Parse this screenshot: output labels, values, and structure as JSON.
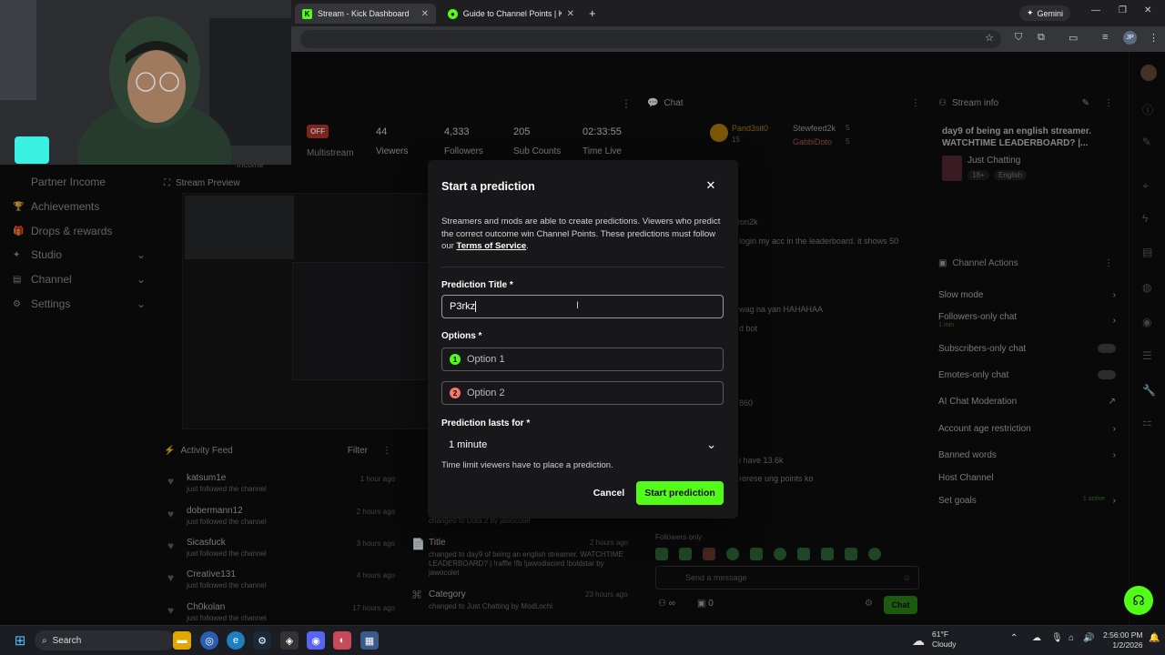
{
  "browser": {
    "tabs": [
      {
        "label": "Stream - Kick Dashboard",
        "active": true
      },
      {
        "label": "Guide to Channel Points | Kick",
        "active": false
      }
    ],
    "new_tab": "+",
    "gemini": "Gemini",
    "profile_initials": "JP"
  },
  "dashboard": {
    "status_badge": "OFF",
    "stats": [
      {
        "value": "44",
        "label": "Viewers"
      },
      {
        "value": "4,333",
        "label": "Followers"
      },
      {
        "value": "205",
        "label": "Sub Counts"
      },
      {
        "value": "02:33:55",
        "label": "Time Live"
      }
    ],
    "multistream_label": "Multistream",
    "income_label": "Income",
    "sidebar": [
      {
        "label": "Partner Income"
      },
      {
        "label": "Achievements"
      },
      {
        "label": "Drops & rewards"
      },
      {
        "label": "Studio"
      },
      {
        "label": "Channel"
      },
      {
        "label": "Settings"
      }
    ],
    "stream_preview_title": "Stream Preview",
    "activity_feed": {
      "title": "Activity Feed",
      "filter": "Filter",
      "items": [
        {
          "name": "katsum1e",
          "sub": "just followed the channel",
          "time": "1 hour ago"
        },
        {
          "name": "dobermann12",
          "sub": "just followed the channel",
          "time": "2 hours ago"
        },
        {
          "name": "Sicasfuck",
          "sub": "just followed the channel",
          "time": "3 hours ago"
        },
        {
          "name": "Creative131",
          "sub": "just followed the channel",
          "time": "4 hours ago"
        },
        {
          "name": "Ch0kolan",
          "sub": "just followed the channel",
          "time": "17 hours ago"
        }
      ]
    },
    "mod_log": {
      "changed_game": "changed to Dota 2 by jawocolet",
      "title_label": "Title",
      "title_time": "2 hours ago",
      "title_desc": "changed to day9 of being an english streamer. WATCHTIME LEADERBOARD? | !raffle !fb !jawodiscord !boldstar by jawocolet",
      "category_label": "Category",
      "category_time": "23 hours ago",
      "category_desc": "changed to Just Chatting by ModLochi"
    },
    "chat": {
      "title": "Chat",
      "top_users": [
        {
          "name": "Pand3sit0",
          "count": "15"
        },
        {
          "name": "Stewfeed2k",
          "count": "5"
        },
        {
          "name": "GabbiDoto",
          "count": "5"
        }
      ],
      "messages": [
        "ron2k",
        "login my acc in the leaderboard. it shows 50",
        "wag na yan HAHAHAA",
        "d bot",
        "860",
        "i have 13.6k",
        "rerese ung points ko"
      ],
      "followers_only": "Followers only",
      "send_placeholder": "Send a message",
      "chat_button": "Chat",
      "count_a": "0"
    },
    "stream_info": {
      "title": "Stream info",
      "stream_title": "day9 of being an english streamer. WATCHTIME LEADERBOARD? |...",
      "category": "Just Chatting",
      "tags": [
        "18+",
        "English"
      ]
    },
    "channel_actions": {
      "title": "Channel Actions",
      "items": [
        {
          "label": "Slow mode",
          "type": "chevron"
        },
        {
          "label": "Followers-only chat",
          "sub": "1 min",
          "type": "chevron"
        },
        {
          "label": "Subscribers-only chat",
          "type": "toggle"
        },
        {
          "label": "Emotes-only chat",
          "type": "toggle"
        },
        {
          "label": "AI Chat Moderation",
          "type": "link"
        },
        {
          "label": "Account age restriction",
          "type": "chevron"
        },
        {
          "label": "Banned words",
          "type": "chevron"
        },
        {
          "label": "Host Channel",
          "type": "none"
        },
        {
          "label": "Set goals",
          "sub": "1 active",
          "type": "chevron"
        }
      ]
    }
  },
  "modal": {
    "title": "Start a prediction",
    "description": "Streamers and mods are able to create predictions. Viewers who predict the correct outcome win Channel Points. These predictions must follow our ",
    "tos_link": "Terms of Service",
    "tos_suffix": ".",
    "title_label": "Prediction Title *",
    "title_value": "P3rkz",
    "options_label": "Options *",
    "option1_placeholder": "Option 1",
    "option2_placeholder": "Option 2",
    "duration_label": "Prediction lasts for *",
    "duration_value": "1 minute",
    "duration_help": "Time limit viewers have to place a prediction.",
    "cancel": "Cancel",
    "submit": "Start prediction",
    "colors": {
      "accent": "#53fc18",
      "option2": "#f5796b"
    }
  },
  "taskbar": {
    "search": "Search",
    "weather_temp": "61°F",
    "weather_desc": "Cloudy",
    "time": "2:56:00 PM",
    "date": "1/2/2026"
  }
}
